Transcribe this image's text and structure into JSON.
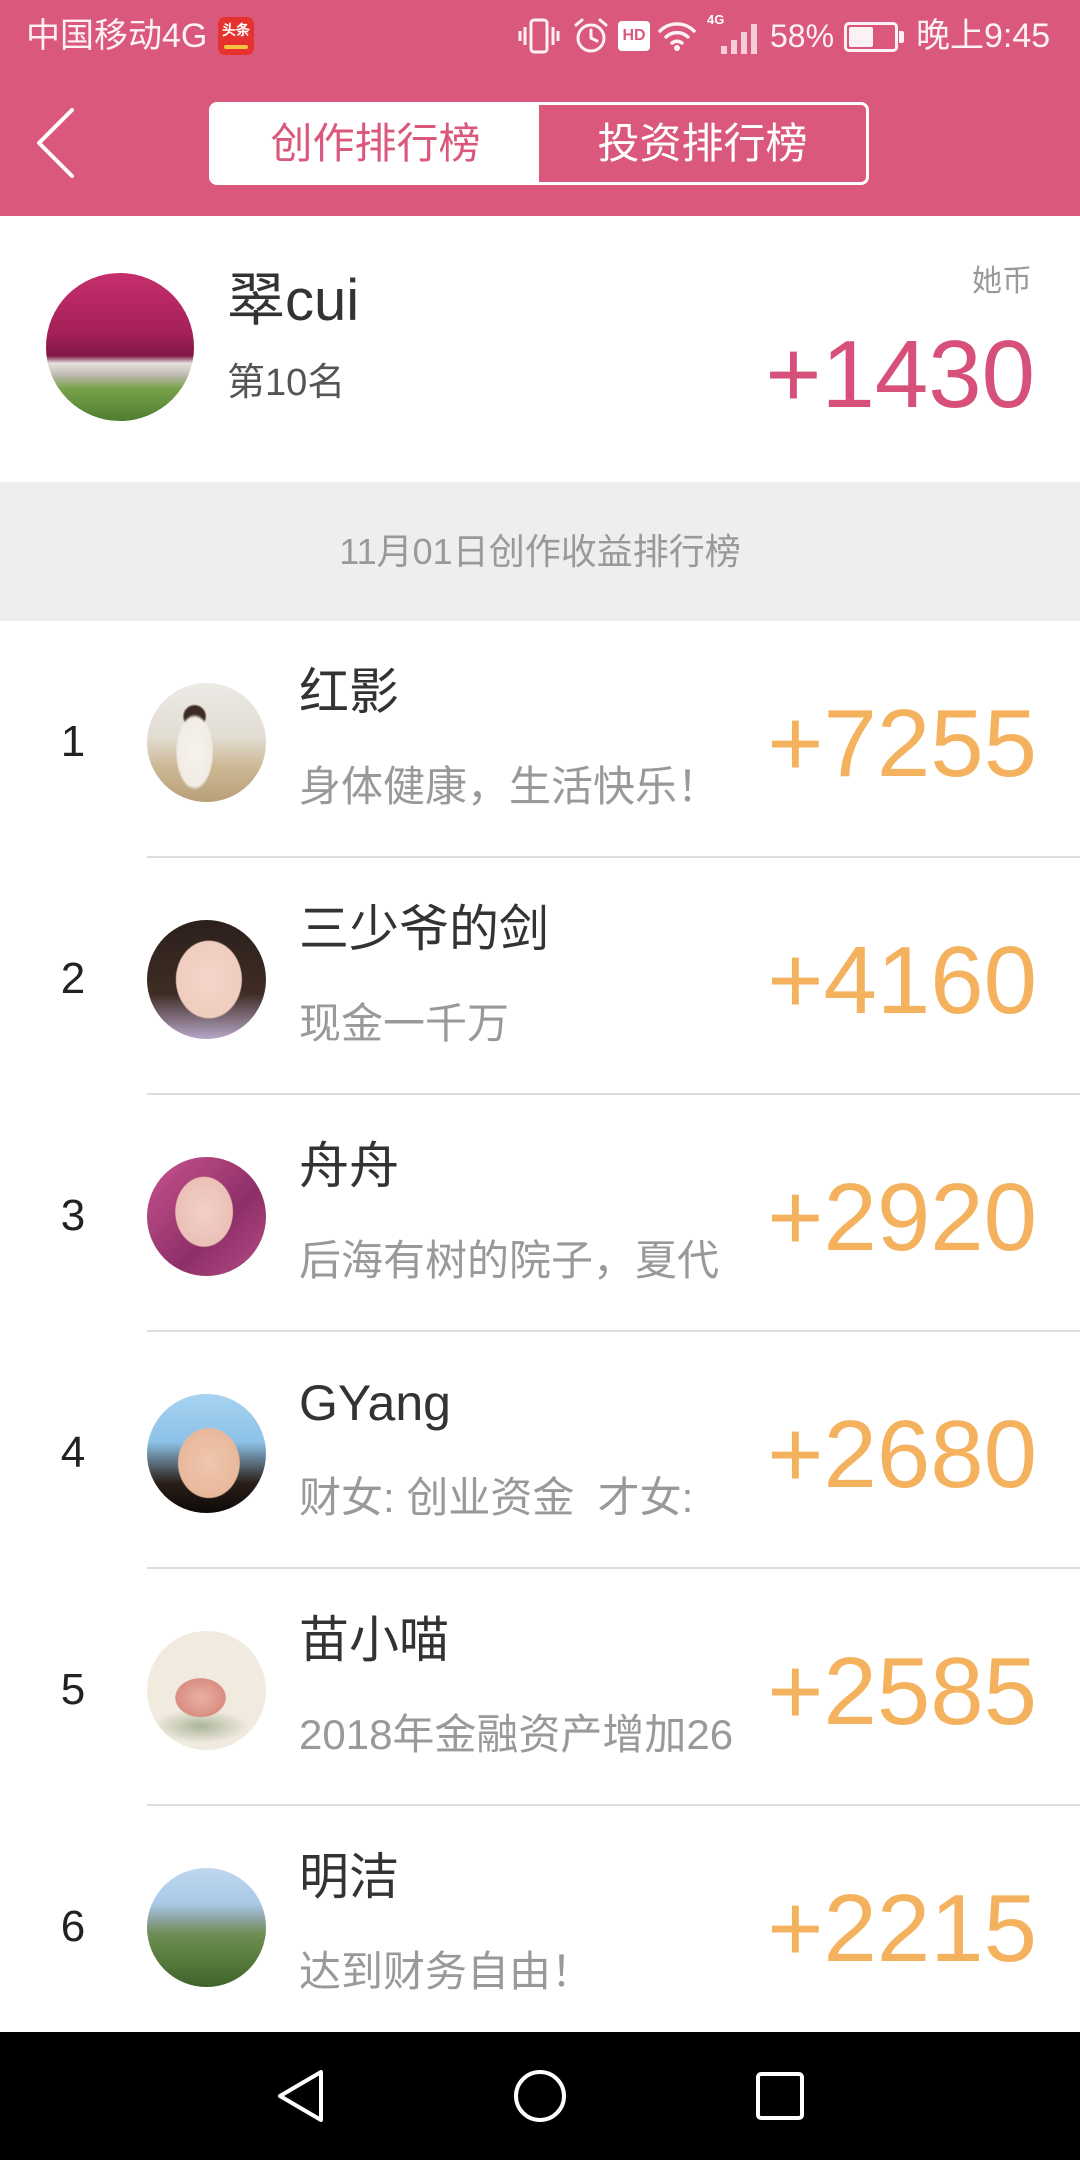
{
  "status_bar": {
    "carrier": "中国移动4G",
    "app_badge": "头条",
    "hd_label": "HD",
    "network_label": "4G",
    "battery_percent": "58%",
    "battery_level": 0.58,
    "time": "晚上9:45",
    "icons": [
      "vibrate-icon",
      "alarm-icon",
      "wifi-icon",
      "signal-icon",
      "battery-icon"
    ]
  },
  "header": {
    "back_icon": "chevron-left-icon",
    "tabs": [
      {
        "label": "创作排行榜",
        "active": true
      },
      {
        "label": "投资排行榜",
        "active": false
      }
    ]
  },
  "my_rank": {
    "name": "翠cui",
    "rank_text": "第10名",
    "currency_label": "她币",
    "score": "+1430"
  },
  "section": {
    "title": "11月01日创作收益排行榜"
  },
  "ranking": [
    {
      "rank": "1",
      "name": "红影",
      "motto": "身体健康，生活快乐！",
      "score": "+7255"
    },
    {
      "rank": "2",
      "name": "三少爷的剑",
      "motto": "现金一千万",
      "score": "+4160"
    },
    {
      "rank": "3",
      "name": "舟舟",
      "motto": "后海有树的院子，夏代",
      "score": "+2920"
    },
    {
      "rank": "4",
      "name": "GYang",
      "motto": "财女: 创业资金  才女:",
      "score": "+2680"
    },
    {
      "rank": "5",
      "name": "苗小喵",
      "motto": "2018年金融资产增加26",
      "score": "+2585"
    },
    {
      "rank": "6",
      "name": "明洁",
      "motto": "达到财务自由！",
      "score": "+2215"
    }
  ],
  "nav_bar": {
    "icons": [
      "back-icon",
      "home-icon",
      "recents-icon"
    ]
  },
  "colors": {
    "accent": "#DA587C",
    "score_pink": "#D6507A",
    "score_orange": "#F4B25F",
    "section_bg": "#EEEEEE"
  }
}
